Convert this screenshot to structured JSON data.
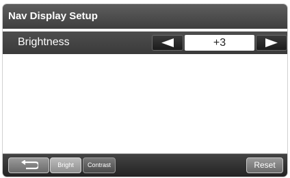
{
  "header": {
    "title": "Nav Display Setup"
  },
  "setting": {
    "label": "Brightness",
    "value": "+3",
    "decrease_icon": "left-triangle-icon",
    "increase_icon": "right-triangle-icon"
  },
  "footer": {
    "back_icon": "return-arrow-icon",
    "tab_bright": "Bright",
    "tab_contrast": "Contrast",
    "reset_label": "Reset"
  }
}
